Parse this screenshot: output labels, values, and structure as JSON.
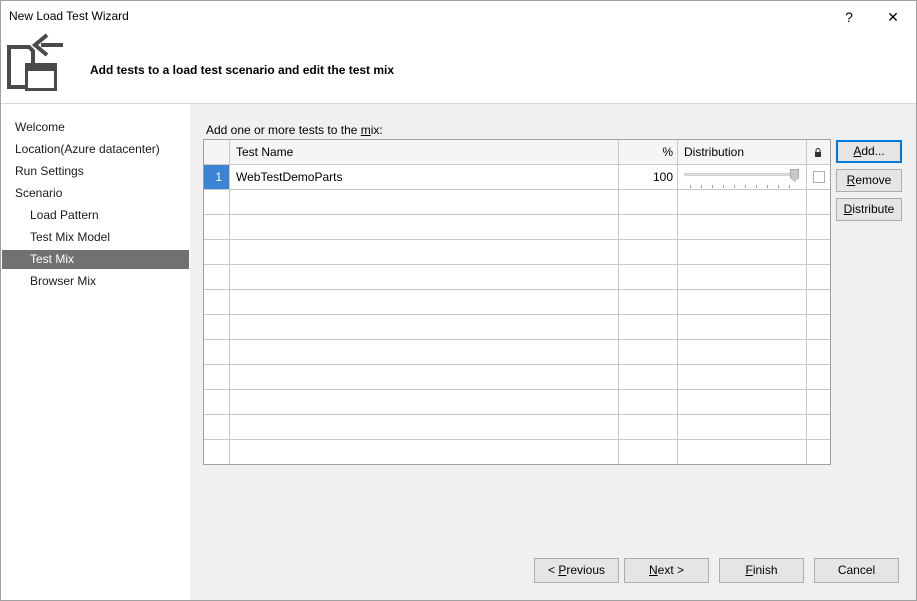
{
  "window": {
    "title": "New Load Test Wizard",
    "help_label": "?",
    "close_label": "✕"
  },
  "header": {
    "heading": "Add tests to a load test scenario and edit the test mix"
  },
  "nav": {
    "items": [
      {
        "label": "Welcome"
      },
      {
        "label": "Location(Azure datacenter)"
      },
      {
        "label": "Run Settings"
      },
      {
        "label": "Scenario"
      },
      {
        "label": "Load Pattern"
      },
      {
        "label": "Test Mix Model"
      },
      {
        "label": "Test Mix"
      },
      {
        "label": "Browser Mix"
      }
    ],
    "selected": "Test Mix"
  },
  "mix": {
    "label_prefix": "Add one or more tests to the ",
    "label_accel": "m",
    "label_suffix": "ix:"
  },
  "grid": {
    "columns": {
      "name": "Test Name",
      "percent": "%",
      "distribution": "Distribution"
    },
    "rows": [
      {
        "index": "1",
        "name": "WebTestDemoParts",
        "percent": "100",
        "distribution_fraction": 1.0,
        "locked": false
      }
    ]
  },
  "buttons": {
    "add": {
      "accel": "A",
      "rest": "dd..."
    },
    "remove": {
      "accel": "R",
      "rest": "emove"
    },
    "distribute": {
      "accel": "D",
      "rest": "istribute"
    },
    "previous": {
      "pre": "< ",
      "accel": "P",
      "rest": "revious"
    },
    "next": {
      "accel": "N",
      "rest": "ext >"
    },
    "finish": {
      "accel": "F",
      "rest": "inish"
    },
    "cancel": {
      "label": "Cancel"
    }
  },
  "colors": {
    "selected_nav": "#717171",
    "selected_index": "#3b83d5",
    "default_button_border": "#0078d7"
  }
}
